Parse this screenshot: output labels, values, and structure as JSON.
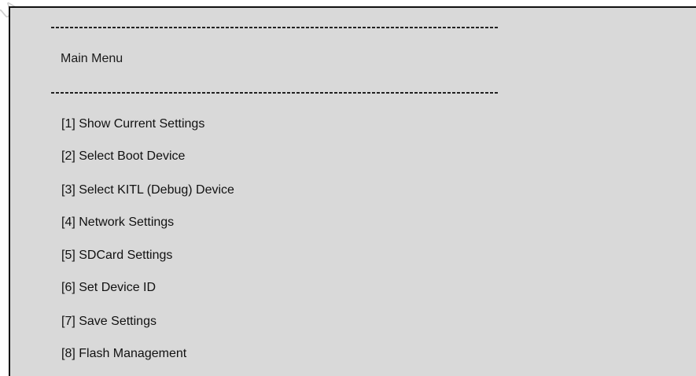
{
  "terminal": {
    "divider_top": "-------------------------------------------------------------------------",
    "title": "Main Menu",
    "divider_bottom": "-------------------------------------------------------------------------",
    "menu_items": [
      {
        "label": "[1] Show Current Settings"
      },
      {
        "label": "[2] Select Boot Device"
      },
      {
        "label": "[3] Select KITL (Debug) Device"
      },
      {
        "label": "[4] Network Settings"
      },
      {
        "label": "[5] SDCard Settings"
      },
      {
        "label": "[6] Set Device ID"
      },
      {
        "label": "[7] Save Settings"
      },
      {
        "label": "[8] Flash Management"
      }
    ]
  }
}
